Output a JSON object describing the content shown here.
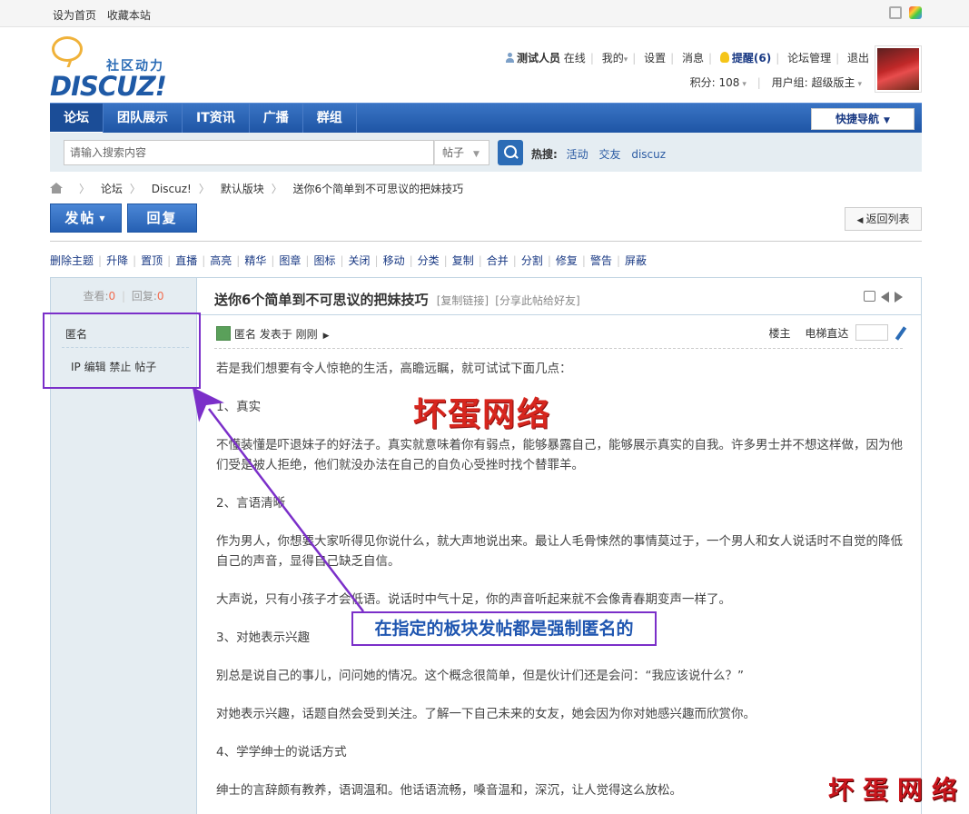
{
  "topbar": {
    "set_home": "设为首页",
    "bookmark": "收藏本站"
  },
  "logo": {
    "cn": "社区动力",
    "en": "DISCUZ!"
  },
  "user": {
    "name": "测试人员",
    "online": "在线",
    "mine": "我的",
    "settings": "设置",
    "messages": "消息",
    "remind": "提醒(6)",
    "forum_manage": "论坛管理",
    "logout": "退出",
    "points": "积分: 108",
    "usergroup": "用户组: 超级版主"
  },
  "nav": {
    "items": [
      "论坛",
      "团队展示",
      "IT资讯",
      "广播",
      "群组"
    ],
    "quick_nav": "快捷导航"
  },
  "search": {
    "placeholder": "请输入搜索内容",
    "type": "帖子",
    "hot_label": "热搜:",
    "hot_terms": [
      "活动",
      "交友",
      "discuz"
    ]
  },
  "breadcrumb": [
    "论坛",
    "Discuz!",
    "默认版块",
    "送你6个简单到不可思议的把妹技巧"
  ],
  "buttons": {
    "post": "发帖",
    "reply": "回复",
    "back": "返回列表"
  },
  "mod_actions": [
    "删除主题",
    "升降",
    "置顶",
    "直播",
    "高亮",
    "精华",
    "图章",
    "图标",
    "关闭",
    "移动",
    "分类",
    "复制",
    "合并",
    "分割",
    "修复",
    "警告",
    "屏蔽"
  ],
  "stats": {
    "views_label": "查看:",
    "views": "0",
    "replies_label": "回复:",
    "replies": "0"
  },
  "side": {
    "author": "匿名",
    "links": "IP 编辑 禁止 帖子"
  },
  "post": {
    "title": "送你6个简单到不可思议的把妹技巧",
    "copy_link": "[复制链接]",
    "share": "[分享此帖给好友]",
    "author_line": "匿名  发表于 刚刚",
    "floor_label": "楼主",
    "elevator": "电梯直达",
    "paragraphs": [
      "若是我们想要有令人惊艳的生活，高瞻远瞩，就可试试下面几点：",
      "1、真实",
      "不懂装懂是吓退妹子的好法子。真实就意味着你有弱点，能够暴露自己，能够展示真实的自我。许多男士并不想这样做，因为他们受是被人拒绝，他们就没办法在自己的自负心受挫时找个替罪羊。",
      "2、言语清晰",
      "作为男人，你想要大家听得见你说什么，就大声地说出来。最让人毛骨悚然的事情莫过于，一个男人和女人说话时不自觉的降低自己的声音，显得自己缺乏自信。",
      "大声说，只有小孩子才会低语。说话时中气十足，你的声音听起来就不会像青春期变声一样了。",
      "3、对她表示兴趣",
      "别总是说自己的事儿，问问她的情况。这个概念很简单，但是伙计们还是会问：“我应该说什么？”",
      "对她表示兴趣，话题自然会受到关注。了解一下自己未来的女友，她会因为你对她感兴趣而欣赏你。",
      "4、学学绅士的说话方式",
      "绅士的言辞颇有教养，语调温和。他话语流畅，嗓音温和，深沉，让人觉得这么放松。"
    ]
  },
  "annotations": {
    "red_title": "坏蛋网络",
    "callout": "在指定的板块发帖都是强制匿名的",
    "watermark": "坏蛋网络"
  },
  "colors": {
    "nav_blue": "#2660b3",
    "annotation_purple": "#7b2fc9",
    "annotation_red": "#d7261e"
  }
}
